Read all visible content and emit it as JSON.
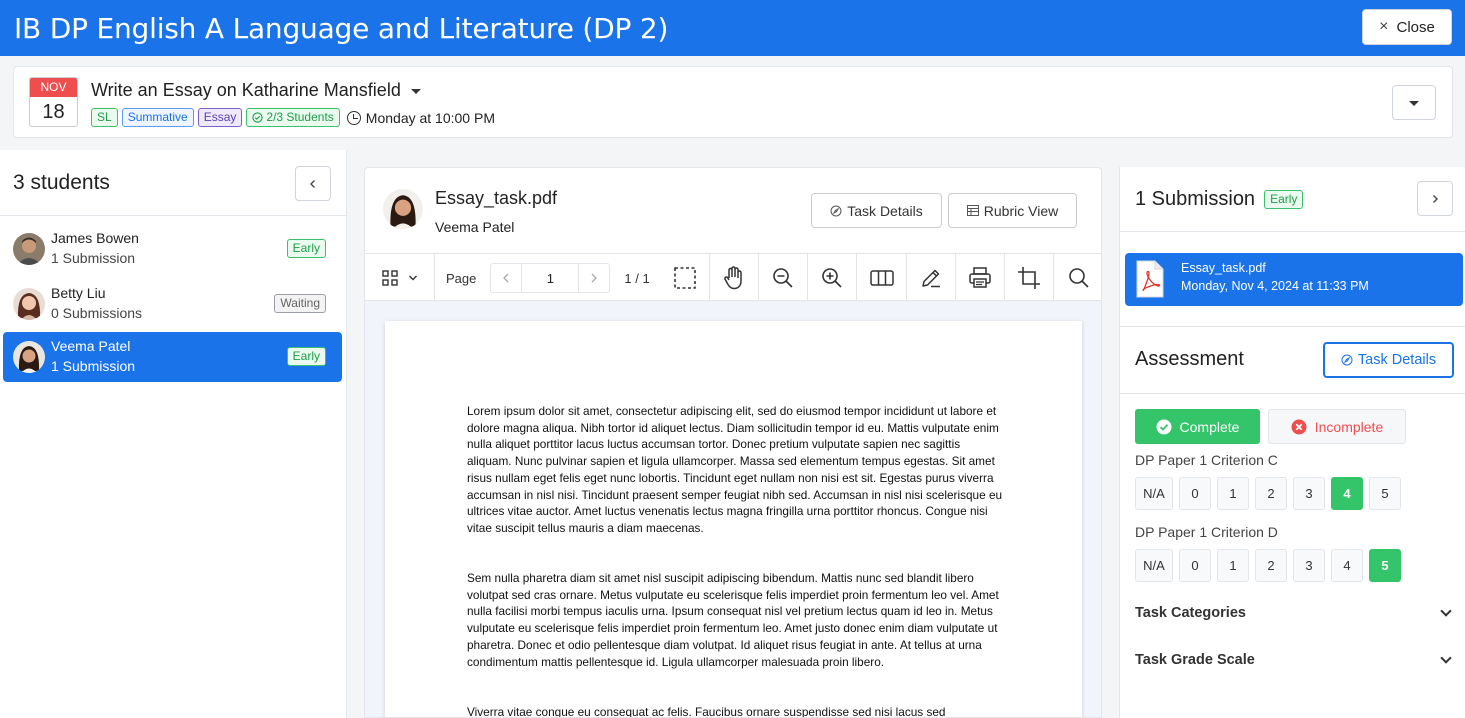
{
  "header": {
    "title": "IB DP English A Language and Literature (DP 2)",
    "close_label": "Close",
    "close_icon": "×"
  },
  "task": {
    "date_month": "NOV",
    "date_day": "18",
    "title": "Write an Essay on Katharine Mansfield",
    "tags": [
      {
        "label": "SL",
        "color": "green"
      },
      {
        "label": "Summative",
        "color": "blue"
      },
      {
        "label": "Essay",
        "color": "purple"
      },
      {
        "label": "2/3 Students",
        "color": "green"
      }
    ],
    "due": "Monday at 10:00 PM"
  },
  "students_panel": {
    "title": "3 students",
    "students": [
      {
        "name": "James Bowen",
        "submissions": "1 Submission",
        "status": "Early"
      },
      {
        "name": "Betty Liu",
        "submissions": "0 Submissions",
        "status": "Waiting"
      },
      {
        "name": "Veema Patel",
        "submissions": "1 Submission",
        "status": "Early"
      }
    ]
  },
  "viewer": {
    "file_name": "Essay_task.pdf",
    "user_name": "Veema Patel",
    "task_details_label": "Task Details",
    "rubric_view_label": "Rubric View",
    "page_label": "Page",
    "page_value": "1",
    "page_total": "1 / 1",
    "paragraphs": [
      "Lorem ipsum dolor sit amet, consectetur adipiscing elit, sed do eiusmod tempor incididunt ut labore et dolore magna aliqua. Nibh tortor id aliquet lectus. Diam sollicitudin tempor id eu. Mattis vulputate enim nulla aliquet porttitor lacus luctus accumsan tortor. Donec pretium vulputate sapien nec sagittis aliquam. Nunc pulvinar sapien et ligula ullamcorper. Massa sed elementum tempus egestas. Sit amet risus nullam eget felis eget nunc lobortis. Tincidunt eget nullam non nisi est sit. Egestas purus viverra accumsan in nisl nisi. Tincidunt praesent semper feugiat nibh sed. Accumsan in nisl nisi scelerisque eu ultrices vitae auctor. Amet luctus venenatis lectus magna fringilla urna porttitor rhoncus. Congue nisi vitae suscipit tellus mauris a diam maecenas.",
      "Sem nulla pharetra diam sit amet nisl suscipit adipiscing bibendum. Mattis nunc sed blandit libero volutpat sed cras ornare. Metus vulputate eu scelerisque felis imperdiet proin fermentum leo vel. Amet nulla facilisi morbi tempus iaculis urna. Ipsum consequat nisl vel pretium lectus quam id leo in. Metus vulputate eu scelerisque felis imperdiet proin fermentum leo. Amet justo donec enim diam vulputate ut pharetra. Donec et odio pellentesque diam volutpat. Id aliquet risus feugiat in ante. At tellus at urna condimentum mattis pellentesque id. Ligula ullamcorper malesuada proin libero.",
      "Viverra vitae congue eu consequat ac felis. Faucibus ornare suspendisse sed nisi lacus sed"
    ]
  },
  "submission_panel": {
    "title": "1 Submission",
    "status": "Early",
    "file_name": "Essay_task.pdf",
    "file_date": "Monday, Nov 4, 2024 at 11:33 PM"
  },
  "assessment": {
    "title": "Assessment",
    "task_details_label": "Task Details",
    "complete_label": "Complete",
    "incomplete_label": "Incomplete",
    "criteria": [
      {
        "label": "DP Paper 1 Criterion C",
        "options": [
          "N/A",
          "0",
          "1",
          "2",
          "3",
          "4",
          "5"
        ],
        "selected": "4"
      },
      {
        "label": "DP Paper 1 Criterion D",
        "options": [
          "N/A",
          "0",
          "1",
          "2",
          "3",
          "4",
          "5"
        ],
        "selected": "5"
      }
    ],
    "sections": [
      "Task Categories",
      "Task Grade Scale"
    ]
  },
  "colors": {
    "primary": "#1a73e8",
    "success": "#34c46a",
    "danger": "#ef4e4e",
    "date_header": "#ef4e4e"
  }
}
